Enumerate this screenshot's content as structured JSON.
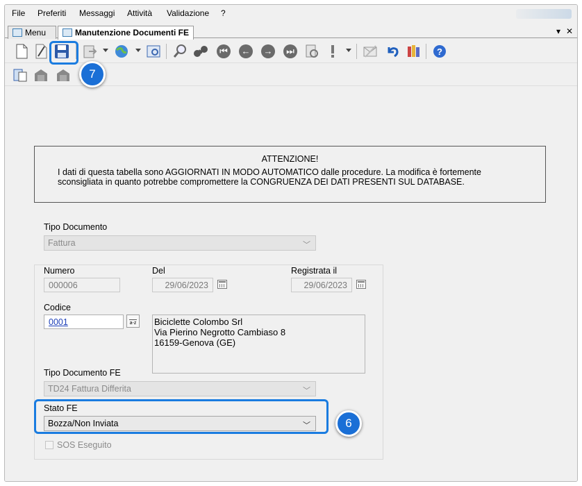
{
  "menu": [
    "File",
    "Preferiti",
    "Messaggi",
    "Attività",
    "Validazione",
    "?"
  ],
  "tabs": [
    {
      "label": "Menu",
      "active": false
    },
    {
      "label": "Manutenzione Documenti FE",
      "active": true
    }
  ],
  "tab_controls": {
    "dropdown": "▾",
    "close": "✕"
  },
  "notice": {
    "title": "ATTENZIONE!",
    "body": "I dati di questa tabella sono AGGIORNATI IN MODO AUTOMATICO dalle procedure. La modifica è fortemente sconsigliata in quanto potrebbe compromettere la CONGRUENZA DEI DATI PRESENTI SUL DATABASE."
  },
  "form": {
    "tipo_documento": {
      "label": "Tipo Documento",
      "value": "Fattura"
    },
    "numero": {
      "label": "Numero",
      "value": "000006"
    },
    "del": {
      "label": "Del",
      "value": "29/06/2023"
    },
    "registrata": {
      "label": "Registrata il",
      "value": "29/06/2023"
    },
    "codice": {
      "label": "Codice",
      "value": "0001"
    },
    "lookup_icon_text": "a-z",
    "address": "Biciclette Colombo Srl\nVia Pierino Negrotto Cambiaso 8\n16159-Genova (GE)",
    "tipo_documento_fe": {
      "label": "Tipo Documento FE",
      "value": "TD24 Fattura Differita"
    },
    "stato_fe": {
      "label": "Stato FE",
      "value": "Bozza/Non Inviata"
    },
    "sos": {
      "label": "SOS Eseguito",
      "checked": false
    }
  },
  "callouts": {
    "save": "7",
    "stato": "6"
  },
  "colors": {
    "accent": "#1a7ce0",
    "callout": "#1a6fd6",
    "link": "#1d3fb8"
  },
  "toolbar_icons": [
    "new-icon",
    "edit-icon",
    "save-icon",
    "export-icon",
    "globe-icon",
    "settings-icon",
    "search-icon",
    "binoculars-icon",
    "first-icon",
    "previous-icon",
    "next-icon",
    "last-icon",
    "refresh-icon",
    "alert-icon",
    "mail-icon",
    "undo-icon",
    "tools-icon",
    "help-icon"
  ]
}
